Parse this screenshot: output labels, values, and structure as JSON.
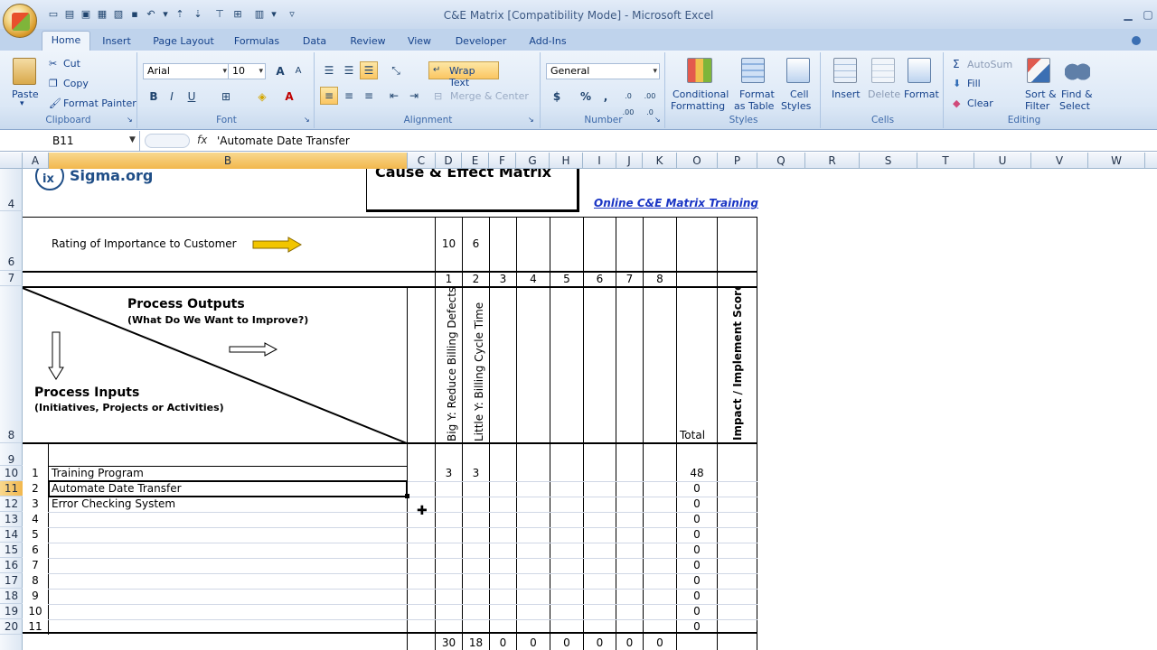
{
  "window": {
    "title": "C&E Matrix  [Compatibility Mode] - Microsoft Excel"
  },
  "tabs": [
    "Home",
    "Insert",
    "Page Layout",
    "Formulas",
    "Data",
    "Review",
    "View",
    "Developer",
    "Add-Ins"
  ],
  "ribbon": {
    "clipboard": {
      "paste": "Paste",
      "cut": "Cut",
      "copy": "Copy",
      "format_painter": "Format Painter",
      "label": "Clipboard"
    },
    "font": {
      "name": "Arial",
      "size": "10",
      "label": "Font",
      "bold": "B",
      "italic": "I",
      "underline": "U",
      "grow": "A",
      "shrink": "A"
    },
    "alignment": {
      "wrap_text": "Wrap Text",
      "merge_center": "Merge & Center",
      "label": "Alignment"
    },
    "number": {
      "format": "General",
      "label": "Number",
      "currency": "$",
      "percent": "%",
      "comma": ",",
      "inc_dec": ".0 .00",
      "dec_dec": ".00 .0"
    },
    "styles": {
      "conditional": "Conditional",
      "formatting": "Formatting",
      "format_as": "Format",
      "as_table": "as Table",
      "cell": "Cell",
      "cell_styles": "Styles",
      "label": "Styles"
    },
    "cells": {
      "insert": "Insert",
      "delete": "Delete",
      "format": "Format",
      "label": "Cells"
    },
    "editing": {
      "autosum": "AutoSum",
      "fill": "Fill",
      "clear": "Clear",
      "sort": "Sort &",
      "filter": "Filter",
      "find": "Find &",
      "select": "Select",
      "label": "Editing"
    }
  },
  "formula_bar": {
    "name_box": "B11",
    "fx": "fx",
    "formula": "'Automate Date Transfer"
  },
  "columns": [
    "A",
    "B",
    "C",
    "D",
    "E",
    "F",
    "G",
    "H",
    "I",
    "J",
    "K",
    "O",
    "P",
    "Q",
    "R",
    "S",
    "T",
    "U",
    "V",
    "W"
  ],
  "row_numbers": [
    "4",
    "6",
    "7",
    "8",
    "9",
    "10",
    "11",
    "12",
    "13",
    "14",
    "15",
    "16",
    "17",
    "18",
    "19",
    "20"
  ],
  "sheet": {
    "logo_text": "Sigma.org",
    "logo_prefix": "ix",
    "matrix_title": "Cause & Effect Matrix",
    "training_link": "Online C&E Matrix Training",
    "rating_label": "Rating of Importance to Customer",
    "ratings": [
      "10",
      "6"
    ],
    "output_numbers": [
      "1",
      "2",
      "3",
      "4",
      "5",
      "6",
      "7",
      "8"
    ],
    "process_outputs": "Process Outputs",
    "process_outputs_sub": "(What Do We Want to Improve?)",
    "process_inputs": "Process Inputs",
    "process_inputs_sub": "(Initiatives, Projects or Activities)",
    "output_1": "Big Y: Reduce Billing Defects",
    "output_2": "Little Y: Billing Cycle Time",
    "total_label": "Total",
    "impact_label": "Impact / Implement Score",
    "rows": [
      {
        "n": "1",
        "name": "Training Program",
        "d": "3",
        "e": "3",
        "total": "48"
      },
      {
        "n": "2",
        "name": "Automate Date Transfer",
        "d": "",
        "e": "",
        "total": "0"
      },
      {
        "n": "3",
        "name": "Error Checking System",
        "d": "",
        "e": "",
        "total": "0"
      },
      {
        "n": "4",
        "name": "",
        "d": "",
        "e": "",
        "total": "0"
      },
      {
        "n": "5",
        "name": "",
        "d": "",
        "e": "",
        "total": "0"
      },
      {
        "n": "6",
        "name": "",
        "d": "",
        "e": "",
        "total": "0"
      },
      {
        "n": "7",
        "name": "",
        "d": "",
        "e": "",
        "total": "0"
      },
      {
        "n": "8",
        "name": "",
        "d": "",
        "e": "",
        "total": "0"
      },
      {
        "n": "9",
        "name": "",
        "d": "",
        "e": "",
        "total": "0"
      },
      {
        "n": "10",
        "name": "",
        "d": "",
        "e": "",
        "total": "0"
      },
      {
        "n": "11",
        "name": "",
        "d": "",
        "e": "",
        "total": "0"
      }
    ],
    "totals_row": [
      "30",
      "18",
      "0",
      "0",
      "0",
      "0",
      "0",
      "0"
    ]
  }
}
